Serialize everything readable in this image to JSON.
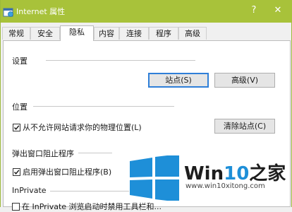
{
  "window": {
    "title": "Internet 属性",
    "help_label": "?",
    "close_label": "✕",
    "icon": "internet-options-icon",
    "accent": "#a8c23a"
  },
  "tabs": [
    {
      "label": "常规",
      "active": false
    },
    {
      "label": "安全",
      "active": false
    },
    {
      "label": "隐私",
      "active": true
    },
    {
      "label": "内容",
      "active": false
    },
    {
      "label": "连接",
      "active": false
    },
    {
      "label": "程序",
      "active": false
    },
    {
      "label": "高级",
      "active": false
    }
  ],
  "settings": {
    "heading": "设置",
    "sites_button": "站点(S)",
    "advanced_button": "高级(V)"
  },
  "location": {
    "heading": "位置",
    "checkbox_label": "从不允许网站请求你的物理位置(L)",
    "checked": true,
    "clear_button": "清除站点(C)"
  },
  "popup": {
    "heading": "弹出窗口阻止程序",
    "checkbox_label": "启用弹出窗口阻止程序(B)",
    "checked": true
  },
  "inprivate": {
    "heading": "InPrivate",
    "checkbox_label": "在 InPrivate 浏览启动时禁用工具栏和..."
  },
  "watermark": {
    "brand_prefix": "Win",
    "brand_number": "10",
    "brand_suffix": "之家",
    "url": "www.win10xitong.com",
    "number_color": "#1e8fd8",
    "logo_color": "#1e8fd8"
  }
}
